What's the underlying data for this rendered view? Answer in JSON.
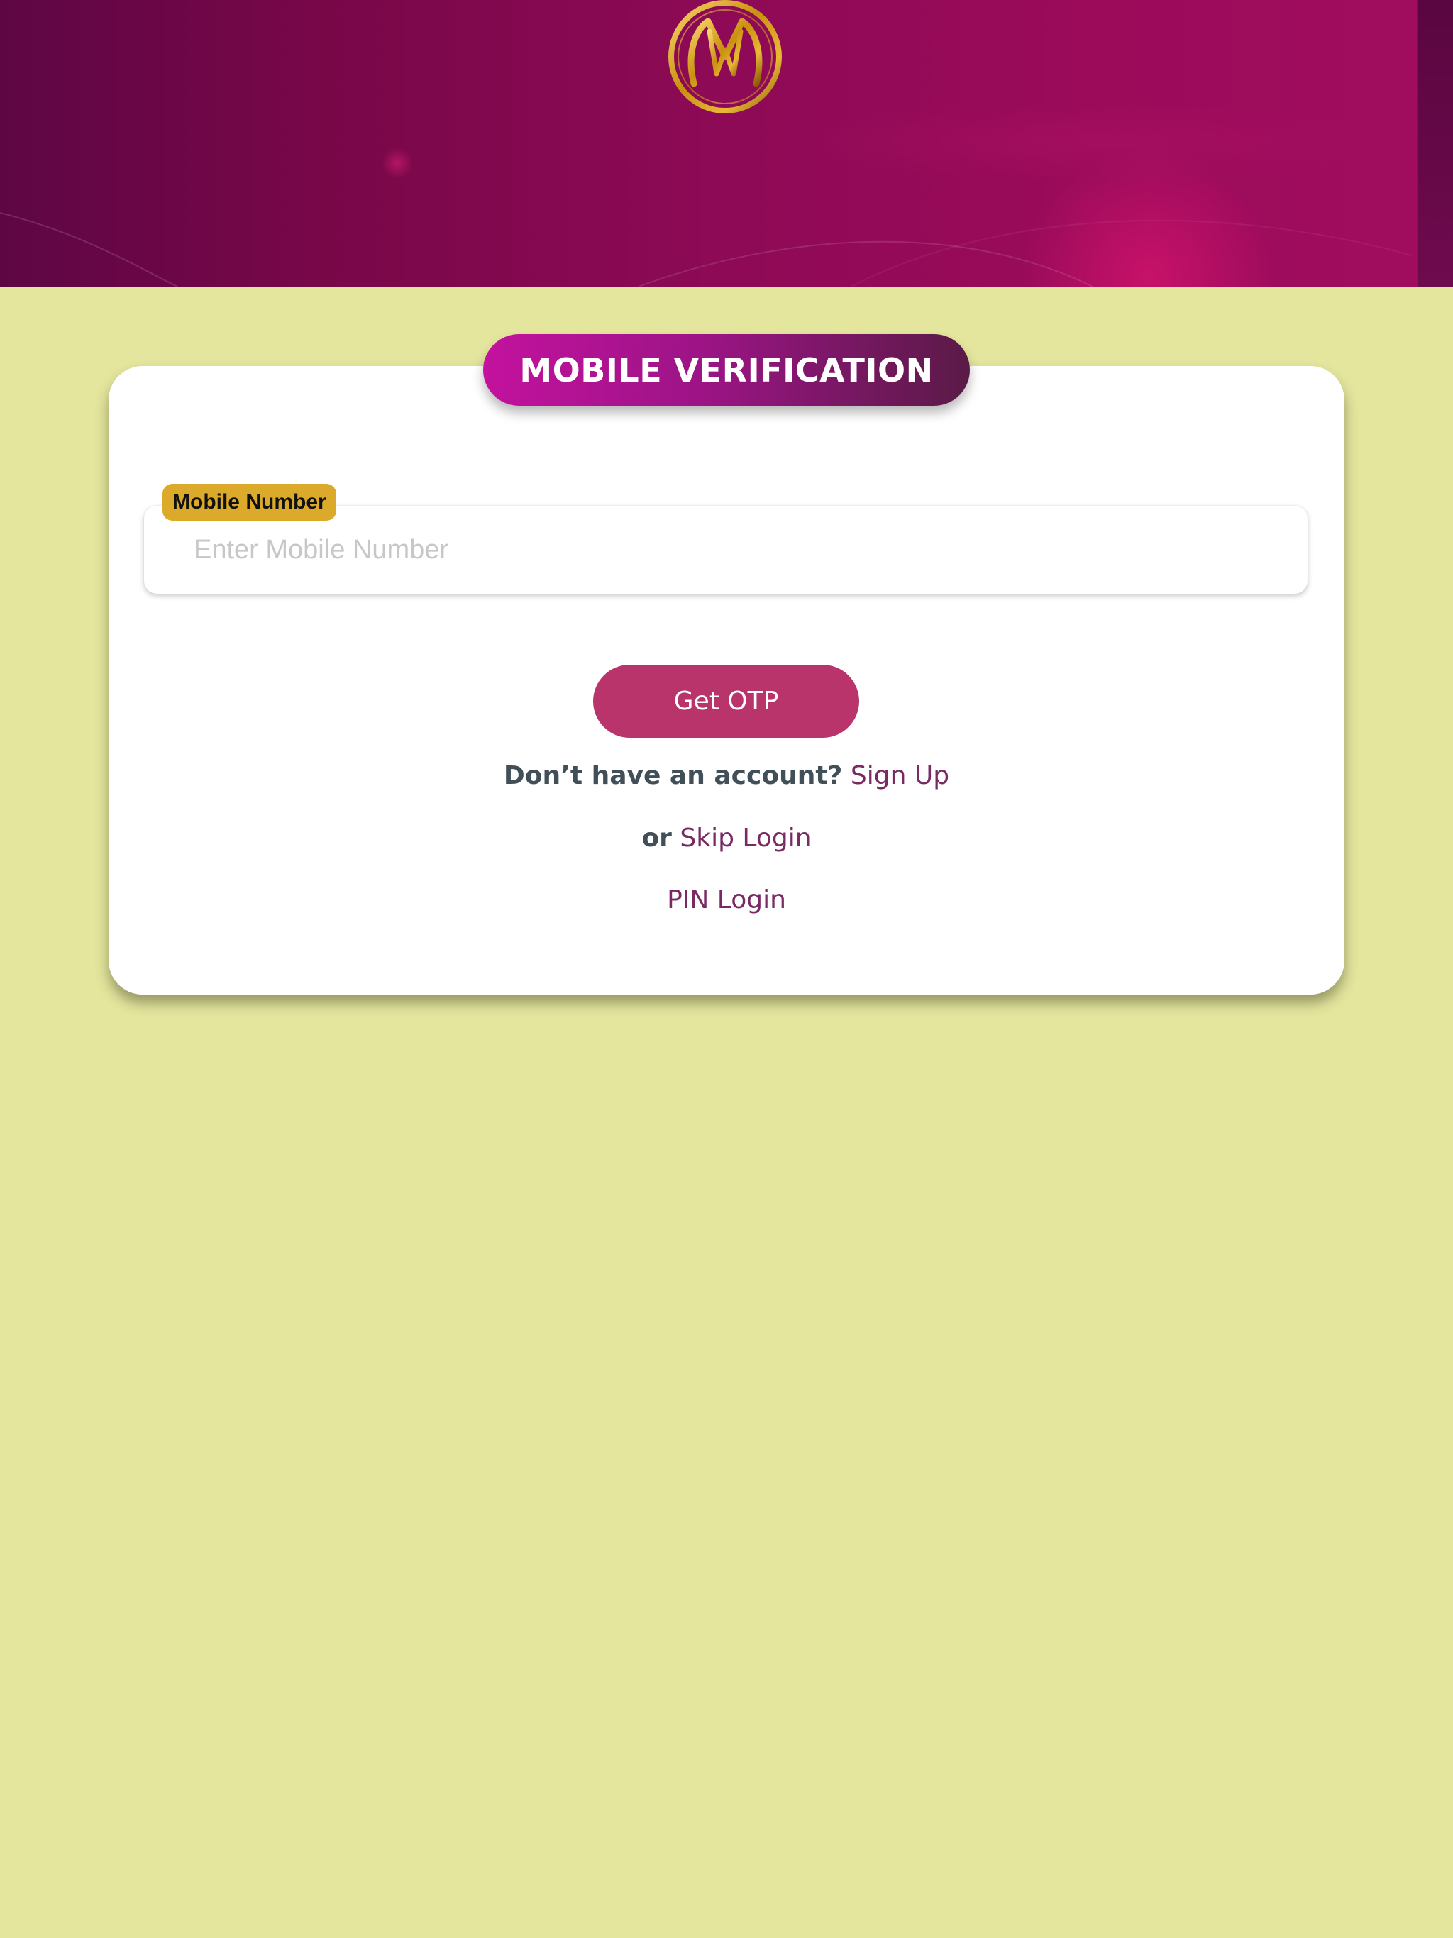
{
  "header": {
    "logo": "gold-ring-m-logo-icon"
  },
  "card": {
    "title": "MOBILE VERIFICATION",
    "mobile_label": "Mobile Number",
    "mobile_placeholder": "Enter Mobile Number",
    "mobile_value": "",
    "get_otp_label": "Get OTP",
    "no_account_text": "Don’t have an account?",
    "sign_up_label": "Sign Up",
    "or_text": "or",
    "skip_login_label": "Skip Login",
    "pin_login_label": "PIN Login"
  },
  "colors": {
    "background": "#e4e69e",
    "header_dark": "#5e0645",
    "header_light": "#a00c5e",
    "title_gradient_start": "#c3129e",
    "title_gradient_end": "#5a1a46",
    "label_badge": "#dcaa2a",
    "otp_button": "#b8346b",
    "link": "#7a2a63",
    "text": "#415058",
    "logo_gold": "#d4a017"
  }
}
